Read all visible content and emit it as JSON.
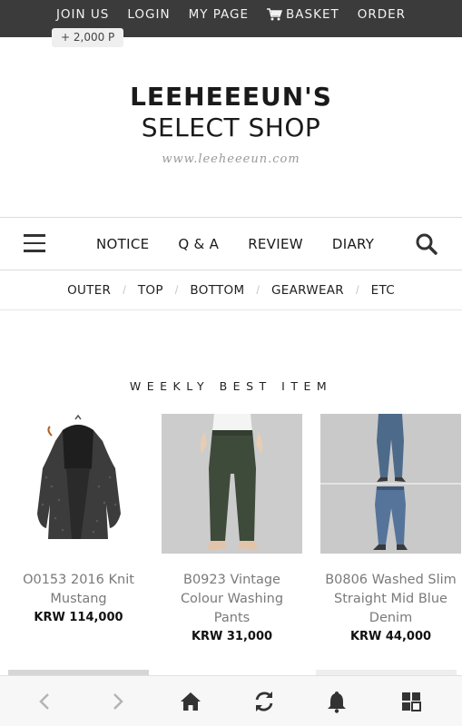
{
  "topbar": {
    "links": [
      {
        "label": "JOIN US"
      },
      {
        "label": "LOGIN"
      },
      {
        "label": "MY PAGE"
      },
      {
        "label": "BASKET",
        "icon": "cart-icon"
      },
      {
        "label": "ORDER"
      }
    ],
    "point_badge": "+ 2,000 P"
  },
  "logo": {
    "line1": "LEEHEEEUN'S",
    "line2": "SELECT SHOP",
    "url": "www.leeheeeun.com"
  },
  "mainnav": {
    "menu_icon": "hamburger-menu-icon",
    "items": [
      {
        "label": "NOTICE"
      },
      {
        "label": "Q & A"
      },
      {
        "label": "REVIEW"
      },
      {
        "label": "DIARY"
      }
    ],
    "search_icon": "search-icon"
  },
  "categories": [
    {
      "label": "OUTER"
    },
    {
      "label": "TOP"
    },
    {
      "label": "BOTTOM"
    },
    {
      "label": "GEARWEAR"
    },
    {
      "label": "ETC"
    }
  ],
  "section": {
    "title": "WEEKLY BEST ITEM"
  },
  "products": [
    {
      "name": "O0153 2016 Knit Mustang",
      "price": "KRW 114,000"
    },
    {
      "name": "B0923 Vintage Colour Washing Pants",
      "price": "KRW 31,000"
    },
    {
      "name": "B0806 Washed Slim Straight Mid Blue Denim",
      "price": "KRW 44,000"
    }
  ],
  "bottombar": {
    "icons": [
      "back-icon",
      "forward-icon",
      "home-icon",
      "refresh-icon",
      "bell-icon",
      "grid-menu-icon"
    ]
  },
  "colors": {
    "topbar_bg": "#3b3b3b",
    "text_dark": "#1a1a1a",
    "product_name": "#7a7a7a",
    "bottombar_bg": "#f7f7f7"
  }
}
